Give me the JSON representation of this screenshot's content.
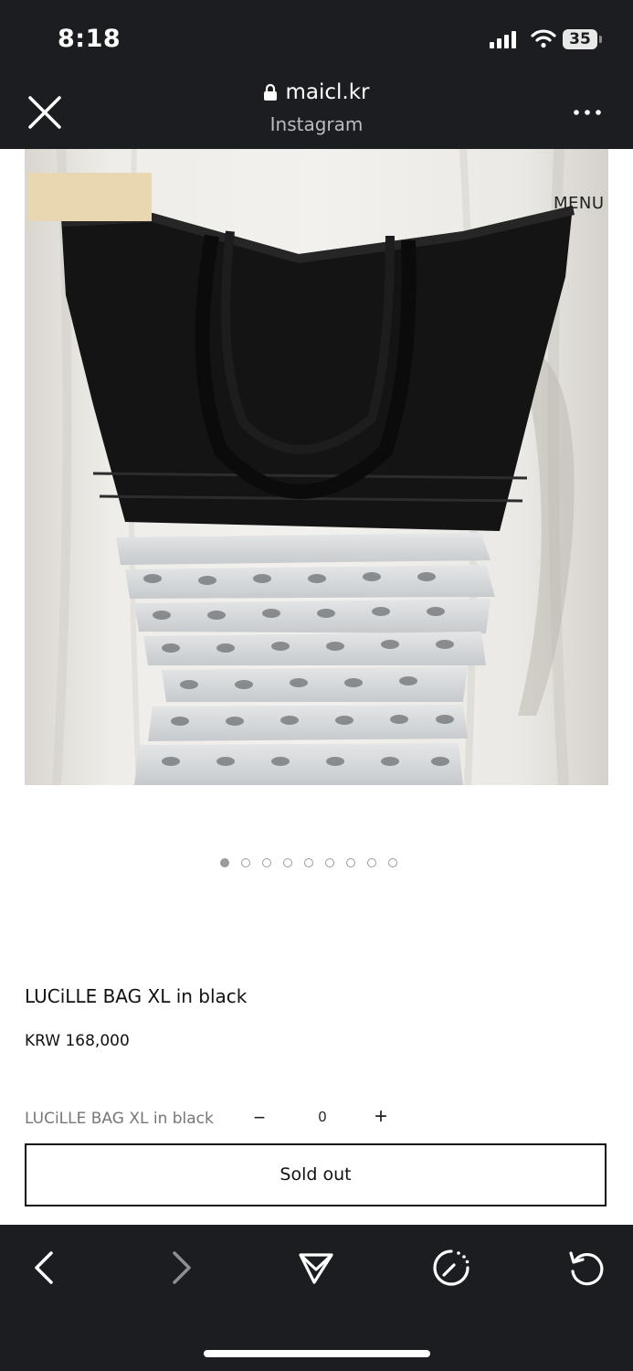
{
  "status_bar": {
    "time": "8:18",
    "battery": "35",
    "signal_icon": "cellular-signal-icon",
    "wifi_icon": "wifi-icon"
  },
  "browser": {
    "url": "maicl.kr",
    "subtitle": "Instagram",
    "close_icon": "close-icon",
    "more_icon": "more-dots-icon",
    "lock_icon": "lock-icon"
  },
  "site": {
    "menu_label": "MENU"
  },
  "gallery": {
    "total_images": 9,
    "active_index": 0
  },
  "product": {
    "title": "LUCiLLE BAG XL in black",
    "price": "KRW 168,000",
    "variant_name": "LUCiLLE BAG XL in black",
    "quantity": "0",
    "minus_label": "−",
    "plus_label": "+",
    "button_label": "Sold out"
  },
  "toolbar": {
    "back_icon": "back-chevron-icon",
    "forward_icon": "forward-chevron-icon",
    "share_icon": "send-icon",
    "timer_icon": "timer-icon",
    "reload_icon": "reload-icon"
  },
  "colors": {
    "chrome_bg": "#1b1d20",
    "logo_patch": "#e8d7b0"
  }
}
